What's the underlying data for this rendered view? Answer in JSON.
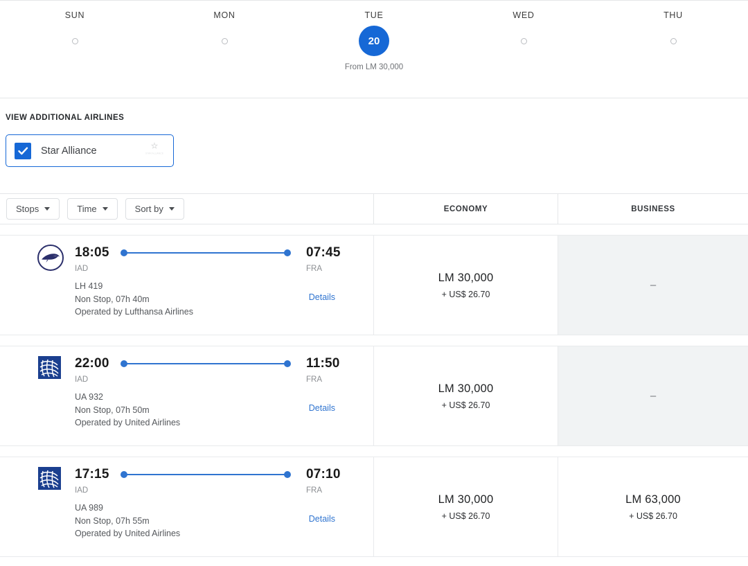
{
  "date_strip": {
    "days": [
      {
        "name": "SUN",
        "selected": false
      },
      {
        "name": "MON",
        "selected": false
      },
      {
        "name": "TUE",
        "selected": true,
        "date": "20",
        "price": "From LM 30,000"
      },
      {
        "name": "WED",
        "selected": false
      },
      {
        "name": "THU",
        "selected": false
      }
    ]
  },
  "airlines": {
    "title": "VIEW ADDITIONAL AIRLINES",
    "alliance": {
      "label": "Star Alliance",
      "checked": true,
      "logo_name": "star-alliance-logo"
    }
  },
  "toolbar": {
    "stops_label": "Stops",
    "time_label": "Time",
    "sort_label": "Sort by"
  },
  "columns": {
    "economy": "ECONOMY",
    "business": "BUSINESS"
  },
  "flights": [
    {
      "airline_logo": "lufthansa-logo",
      "depart_time": "18:05",
      "depart_code": "IAD",
      "arrive_time": "07:45",
      "arrive_code": "FRA",
      "flight_number": "LH 419",
      "duration": "Non Stop, 07h 40m",
      "operated_by": "Operated by Lufthansa Airlines",
      "details_label": "Details",
      "economy": {
        "miles": "LM 30,000",
        "tax": "+ US$ 26.70",
        "available": true
      },
      "business": {
        "miles": "",
        "tax": "",
        "available": false,
        "dash": "–"
      }
    },
    {
      "airline_logo": "united-logo",
      "depart_time": "22:00",
      "depart_code": "IAD",
      "arrive_time": "11:50",
      "arrive_code": "FRA",
      "flight_number": "UA 932",
      "duration": "Non Stop, 07h 50m",
      "operated_by": "Operated by United Airlines",
      "details_label": "Details",
      "economy": {
        "miles": "LM 30,000",
        "tax": "+ US$ 26.70",
        "available": true
      },
      "business": {
        "miles": "",
        "tax": "",
        "available": false,
        "dash": "–"
      }
    },
    {
      "airline_logo": "united-logo",
      "depart_time": "17:15",
      "depart_code": "IAD",
      "arrive_time": "07:10",
      "arrive_code": "FRA",
      "flight_number": "UA 989",
      "duration": "Non Stop, 07h 55m",
      "operated_by": "Operated by United Airlines",
      "details_label": "Details",
      "economy": {
        "miles": "LM 30,000",
        "tax": "+ US$ 26.70",
        "available": true
      },
      "business": {
        "miles": "LM 63,000",
        "tax": "+ US$ 26.70",
        "available": true
      }
    }
  ],
  "colors": {
    "accent_blue": "#1668d6",
    "path_blue": "#2f74d0",
    "unavailable_bg": "#f1f3f4",
    "lufthansa_navy": "#2b2f6b",
    "united_blue": "#1b3f8f"
  }
}
